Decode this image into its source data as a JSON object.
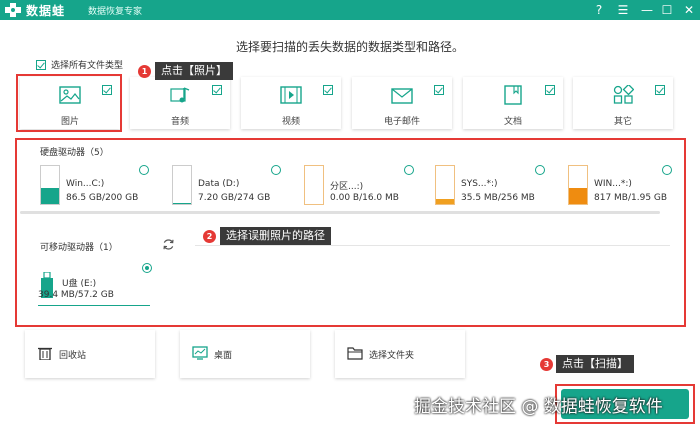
{
  "app": {
    "name": "数据蛙",
    "subtitle": "数据恢复专家",
    "window_controls": [
      "?",
      "☰",
      "—",
      "☐",
      "✕"
    ]
  },
  "heading": "选择要扫描的丢失数据的数据类型和路径。",
  "select_all": {
    "label": "选择所有文件类型",
    "checked": true
  },
  "file_types": [
    {
      "label": "图片",
      "icon": "image-icon",
      "checked": true
    },
    {
      "label": "音频",
      "icon": "music-icon",
      "checked": true
    },
    {
      "label": "视频",
      "icon": "video-icon",
      "checked": true
    },
    {
      "label": "电子邮件",
      "icon": "mail-icon",
      "checked": true
    },
    {
      "label": "文档",
      "icon": "document-icon",
      "checked": true
    },
    {
      "label": "其它",
      "icon": "other-icon",
      "checked": true
    }
  ],
  "annotations": {
    "step1": {
      "num": "1",
      "text": "点击【照片】"
    },
    "step2": {
      "num": "2",
      "text": "选择误删照片的路径"
    },
    "step3": {
      "num": "3",
      "text": "点击【扫描】"
    }
  },
  "hard_drives": {
    "title": "硬盘驱动器（5）",
    "items": [
      {
        "name": "Win...C:)",
        "size": "86.5 GB/200 GB",
        "fill": 0.43,
        "color": "#16a58b"
      },
      {
        "name": "Data (D:)",
        "size": "7.20 GB/274 GB",
        "fill": 0.03,
        "color": "#16a58b"
      },
      {
        "name": "分区...:)",
        "size": "0.00  B/16.0 MB",
        "fill": 0.0,
        "color": "#16a58b"
      },
      {
        "name": "SYS...*:)",
        "size": "35.5 MB/256 MB",
        "fill": 0.14,
        "color": "#f0a020"
      },
      {
        "name": "WIN...*:)",
        "size": "817 MB/1.95 GB",
        "fill": 0.42,
        "color": "#ef8c10"
      }
    ]
  },
  "removable_drives": {
    "title": "可移动驱动器（1）",
    "items": [
      {
        "name": "U盘 (E:)",
        "size": "39.4 MB/57.2 GB",
        "selected": true
      }
    ]
  },
  "locations": [
    {
      "label": "回收站",
      "icon": "recycle-bin-icon"
    },
    {
      "label": "桌面",
      "icon": "desktop-icon"
    },
    {
      "label": "选择文件夹",
      "icon": "folder-icon"
    }
  ],
  "watermark": "掘金技术社区 @ 数据蛙恢复软件",
  "colors": {
    "brand": "#16a58b",
    "annotation": "#e53935",
    "callout": "#3a3a3a"
  }
}
